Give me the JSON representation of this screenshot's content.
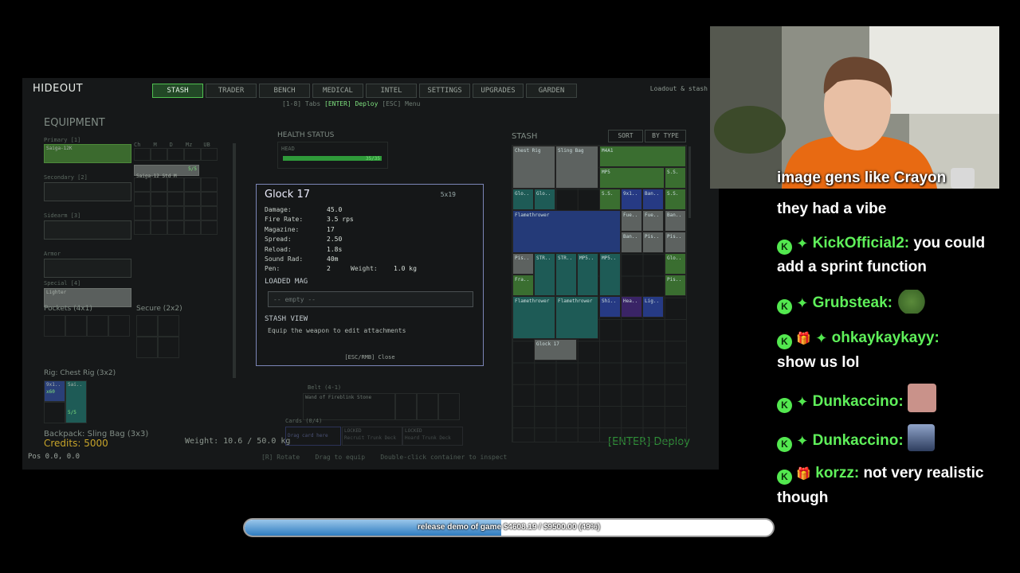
{
  "game": {
    "title": "HIDEOUT",
    "tabs": [
      "STASH",
      "TRADER",
      "BENCH",
      "MEDICAL",
      "INTEL",
      "SETTINGS",
      "UPGRADES",
      "GARDEN"
    ],
    "active_tab": "STASH",
    "header_right": "Loadout & stash",
    "hint_prefix": "[1-8] Tabs",
    "hint_enter": "[ENTER] Deploy",
    "hint_suffix": "[ESC] Menu",
    "equipment": {
      "heading": "EQUIPMENT",
      "primary_label": "Primary [1]",
      "primary_item": "Saiga-12K",
      "secondary_label": "Secondary [2]",
      "sidearm_label": "Sidearm [3]",
      "armor_label": "Armor",
      "special_label": "Special [4]",
      "special_item": "Lighter",
      "pockets_label": "Pockets (4x1)",
      "secure_label": "Secure (2x2)",
      "rig_label": "Rig: Chest Rig (3x2)",
      "rig_item1": "9x1..",
      "rig_item1_sub": "x60",
      "rig_item2": "Sai..",
      "rig_item2_sub": "5/5",
      "backpack_label": "Backpack: Sling Bag (3x3)",
      "credits": "Credits: 5000",
      "weight": "Weight: 10.6 / 50.0 kg",
      "pos": "Pos 0.0, 0.0",
      "attach_item": "Saiga-12 Std M",
      "attach_count": "5/5",
      "attach_labels": [
        "Ch",
        "M",
        "D",
        "Mz",
        "UB"
      ]
    },
    "health": {
      "heading": "HEALTH STATUS",
      "head_label": "HEAD",
      "head_value": "35/35",
      "head_level": 1.0
    },
    "stash": {
      "heading": "STASH",
      "sort": "SORT",
      "by_type": "BY TYPE",
      "items": {
        "chest_rig": "Chest Rig",
        "sling_bag": "Sling Bag",
        "m4a1": "M4A1",
        "m4a1_sub": "30/30",
        "mp5": "MP5",
        "mp5_sub": "30/30",
        "ss": "S.S.",
        "ss_sub": "x60",
        "glo": "Glo..",
        "glo_sub": "17/17",
        "flamethrower": "Flamethrower",
        "fue": "Fue..",
        "fue_sub": "7/8",
        "ban": "Ban..",
        "pis": "Pis..",
        "str": "STR..",
        "mp5s": "MP5..",
        "fra": "Fra..",
        "mag_sub": "30/30",
        "hea": "Hea..",
        "lig": "Lig..",
        "shi": "Shi..",
        "glock_small": "Glock 17"
      }
    },
    "belt_label": "Belt (4-1)",
    "belt_item": "Wand of Fireblink Stone",
    "cards_label": "Cards (0/4)",
    "cards_drop": "Drag card here",
    "locked1": "LOCKED",
    "locked1_sub": "Recruit Trunk Deck",
    "locked2": "LOCKED",
    "locked2_sub": "Hoard Trunk Deck",
    "footer_hint1": "[R] Rotate",
    "footer_hint2": "Drag to equip",
    "footer_hint3": "Double-click container to inspect",
    "deploy": "[ENTER] Deploy"
  },
  "modal": {
    "title": "Glock 17",
    "size": "5x19",
    "stats": [
      {
        "k": "Damage:",
        "v": "45.0"
      },
      {
        "k": "Fire Rate:",
        "v": "3.5 rps"
      },
      {
        "k": "Magazine:",
        "v": "17"
      },
      {
        "k": "Spread:",
        "v": "2.50"
      },
      {
        "k": "Reload:",
        "v": "1.8s"
      },
      {
        "k": "Sound Rad:",
        "v": "40m"
      },
      {
        "k": "Pen:",
        "v": "2"
      }
    ],
    "weight_label": "Weight:",
    "weight_value": "1.0 kg",
    "loaded_mag_heading": "LOADED MAG",
    "loaded_mag_value": "-- empty --",
    "stash_view_heading": "STASH VIEW",
    "stash_view_text": "Equip the weapon to edit attachments",
    "close_hint": "[ESC/RMB] Close"
  },
  "chat": [
    {
      "user": "",
      "message": "image gens like Crayon",
      "badges": []
    },
    {
      "user": "",
      "message": "they had a vibe",
      "badges": []
    },
    {
      "user": "KickOfficial2:",
      "message": "you could add a sprint function",
      "badges": [
        "k",
        "gem"
      ]
    },
    {
      "user": "Grubsteak:",
      "message": "",
      "badges": [
        "k",
        "gem"
      ]
    },
    {
      "user": "ohkaykaykayy:",
      "message": "show us lol",
      "badges": [
        "k",
        "gift",
        "gem"
      ]
    },
    {
      "user": "Dunkaccino:",
      "message": "",
      "badges": [
        "k",
        "gem"
      ]
    },
    {
      "user": "Dunkaccino:",
      "message": "",
      "badges": [
        "k",
        "gem"
      ]
    },
    {
      "user": "korzz:",
      "message": "not very realistic though",
      "badges": [
        "k",
        "gift2"
      ]
    }
  ],
  "goal": {
    "text": "release demo of game $4608.19 / $9500.00 (49%)",
    "fraction": 0.485
  },
  "colors": {
    "active_tab": "#224826",
    "chat_user": "#5ff05a",
    "goal_fill": "#2f7cc0",
    "modal_border": "#7c86b8"
  }
}
